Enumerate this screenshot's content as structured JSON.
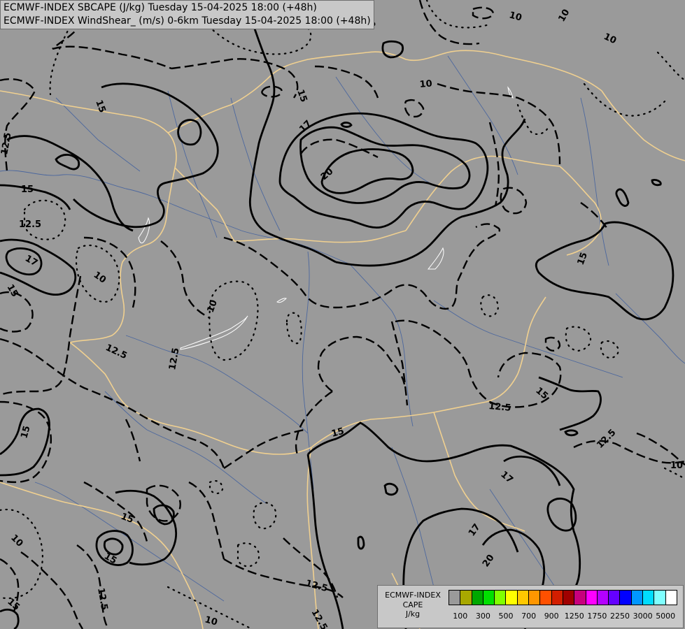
{
  "header": {
    "line1": "ECMWF-INDEX SBCAPE (J/kg) Tuesday 15-04-2025 18:00 (+48h)",
    "line2": "ECMWF-INDEX WindShear_ (m/s) 0-6km Tuesday 15-04-2025 18:00 (+48h)"
  },
  "contour_labels": {
    "l10": "10",
    "l12_5": "12.5",
    "l15": "15",
    "l17": "17",
    "l20": "20"
  },
  "colors": {
    "background": "#9a9a9a",
    "borders": "#f0d090",
    "rivers": "#3f5f9f",
    "contours": "#000000"
  },
  "legend": {
    "title": [
      "ECMWF-INDEX",
      "CAPE",
      "J/kg"
    ],
    "swatches": [
      "#9a9a9a",
      "#a8a800",
      "#00a800",
      "#00e000",
      "#80ff00",
      "#ffff00",
      "#ffc800",
      "#ff9600",
      "#ff5000",
      "#d21e00",
      "#a00000",
      "#c8007d",
      "#ff00ff",
      "#b400ff",
      "#6400ff",
      "#0000ff",
      "#0096ff",
      "#00dcff",
      "#80ffff",
      "#ffffff"
    ],
    "ticks": [
      "100",
      "300",
      "500",
      "700",
      "900",
      "1250",
      "1750",
      "2250",
      "3000",
      "5000"
    ]
  }
}
